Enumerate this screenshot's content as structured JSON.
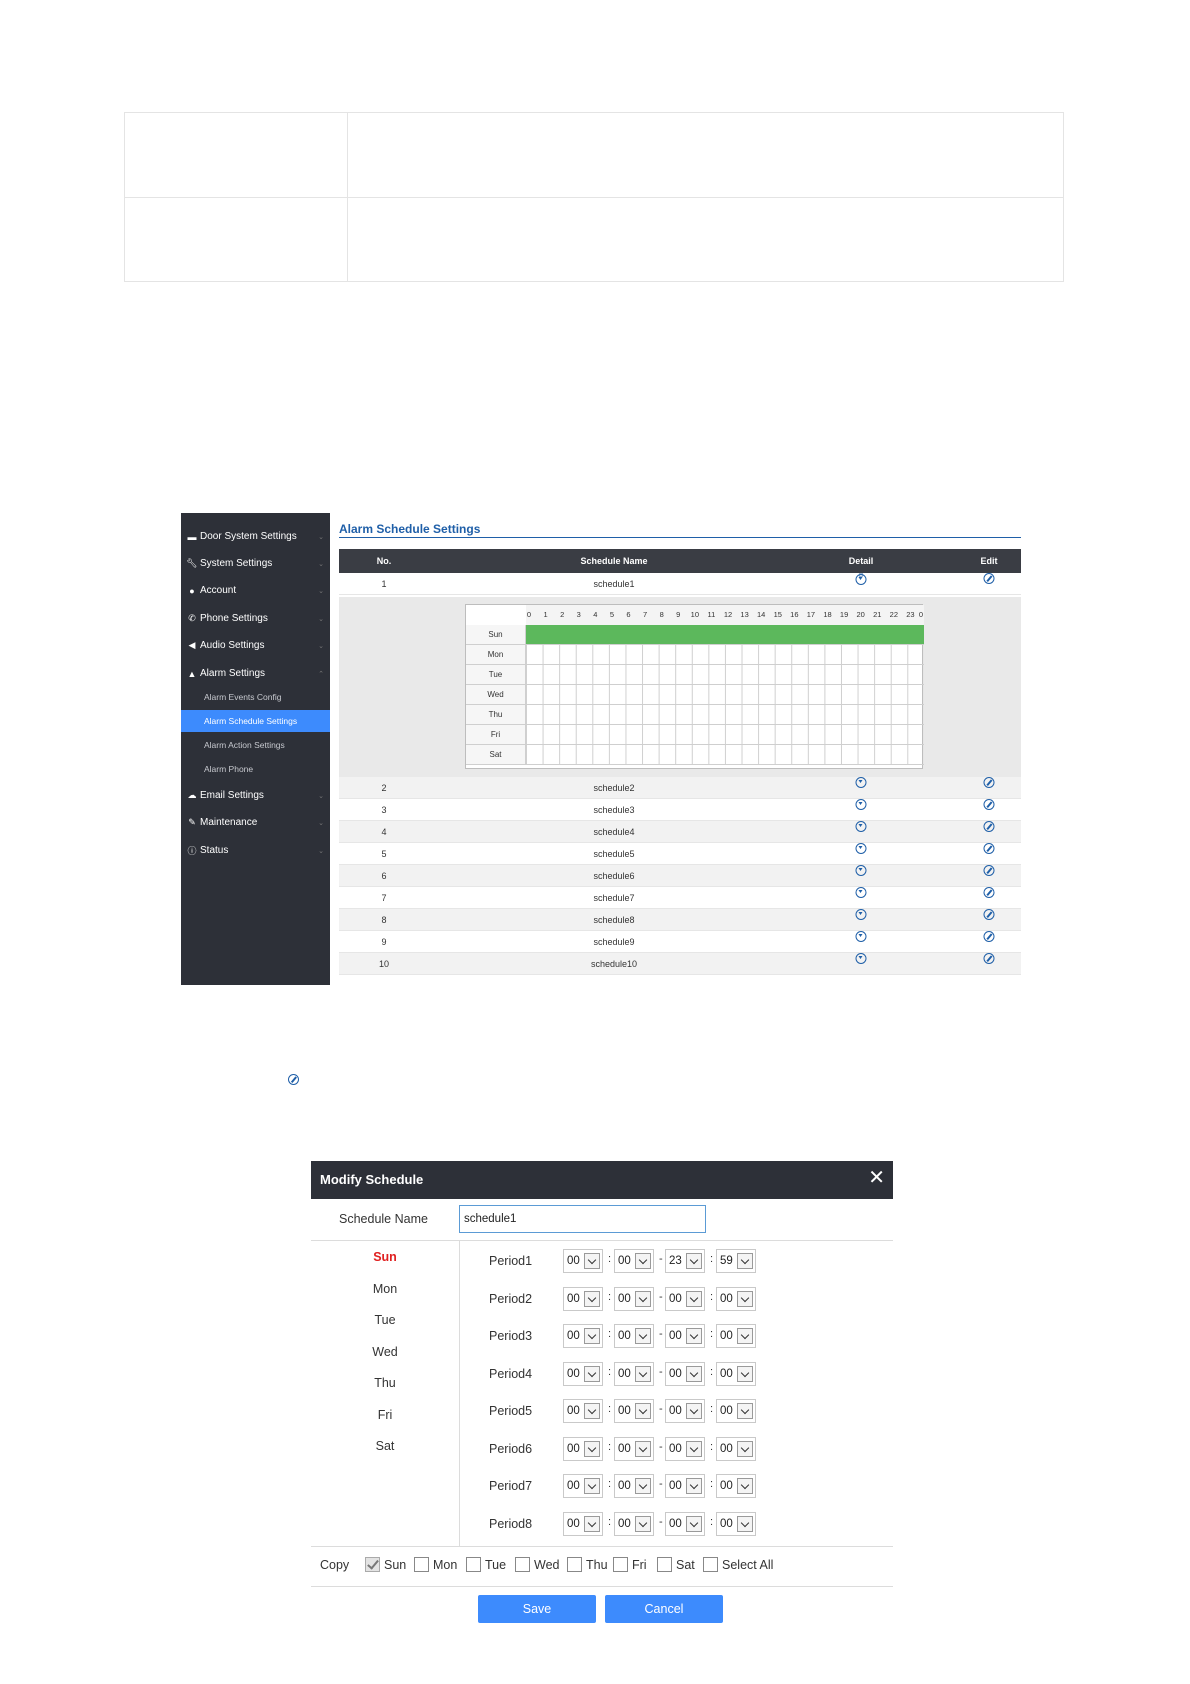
{
  "sidebar": {
    "items": [
      {
        "label": "Door System Settings",
        "icon": "card-icon"
      },
      {
        "label": "System Settings",
        "icon": "wrench-icon"
      },
      {
        "label": "Account",
        "icon": "user-icon"
      },
      {
        "label": "Phone Settings",
        "icon": "phone-icon"
      },
      {
        "label": "Audio Settings",
        "icon": "speaker-icon"
      },
      {
        "label": "Alarm Settings",
        "icon": "bell-icon"
      },
      {
        "label": "Email Settings",
        "icon": "cloud-icon"
      },
      {
        "label": "Maintenance",
        "icon": "tool-icon"
      },
      {
        "label": "Status",
        "icon": "info-icon"
      }
    ],
    "alarm_sub_items": [
      {
        "label": "Alarm Events Config"
      },
      {
        "label": "Alarm Schedule Settings",
        "active": true
      },
      {
        "label": "Alarm Action Settings"
      },
      {
        "label": "Alarm Phone"
      }
    ]
  },
  "schedule_page": {
    "title": "Alarm Schedule Settings",
    "columns": {
      "no": "No.",
      "name": "Schedule Name",
      "detail": "Detail",
      "edit": "Edit"
    },
    "rows": [
      {
        "no": "1",
        "name": "schedule1"
      },
      {
        "no": "2",
        "name": "schedule2"
      },
      {
        "no": "3",
        "name": "schedule3"
      },
      {
        "no": "4",
        "name": "schedule4"
      },
      {
        "no": "5",
        "name": "schedule5"
      },
      {
        "no": "6",
        "name": "schedule6"
      },
      {
        "no": "7",
        "name": "schedule7"
      },
      {
        "no": "8",
        "name": "schedule8"
      },
      {
        "no": "9",
        "name": "schedule9"
      },
      {
        "no": "10",
        "name": "schedule10"
      }
    ],
    "detail_grid": {
      "hours": [
        "0",
        "1",
        "2",
        "3",
        "4",
        "5",
        "6",
        "7",
        "8",
        "9",
        "10",
        "11",
        "12",
        "13",
        "14",
        "15",
        "16",
        "17",
        "18",
        "19",
        "20",
        "21",
        "22",
        "23",
        "0"
      ],
      "days": [
        "Sun",
        "Mon",
        "Tue",
        "Wed",
        "Thu",
        "Fri",
        "Sat"
      ],
      "active_days": [
        "Sun"
      ],
      "active_color": "#5cb85c"
    }
  },
  "modal": {
    "title": "Modify Schedule",
    "close_icon": "close-icon",
    "name_label": "Schedule Name",
    "name_value": "schedule1",
    "days": [
      "Sun",
      "Mon",
      "Tue",
      "Wed",
      "Thu",
      "Fri",
      "Sat"
    ],
    "active_day": "Sun",
    "periods": [
      {
        "label": "Period1",
        "start_h": "00",
        "start_m": "00",
        "end_h": "23",
        "end_m": "59"
      },
      {
        "label": "Period2",
        "start_h": "00",
        "start_m": "00",
        "end_h": "00",
        "end_m": "00"
      },
      {
        "label": "Period3",
        "start_h": "00",
        "start_m": "00",
        "end_h": "00",
        "end_m": "00"
      },
      {
        "label": "Period4",
        "start_h": "00",
        "start_m": "00",
        "end_h": "00",
        "end_m": "00"
      },
      {
        "label": "Period5",
        "start_h": "00",
        "start_m": "00",
        "end_h": "00",
        "end_m": "00"
      },
      {
        "label": "Period6",
        "start_h": "00",
        "start_m": "00",
        "end_h": "00",
        "end_m": "00"
      },
      {
        "label": "Period7",
        "start_h": "00",
        "start_m": "00",
        "end_h": "00",
        "end_m": "00"
      },
      {
        "label": "Period8",
        "start_h": "00",
        "start_m": "00",
        "end_h": "00",
        "end_m": "00"
      }
    ],
    "copy_label": "Copy",
    "copy_options": [
      {
        "label": "Sun",
        "checked": true
      },
      {
        "label": "Mon",
        "checked": false
      },
      {
        "label": "Tue",
        "checked": false
      },
      {
        "label": "Wed",
        "checked": false
      },
      {
        "label": "Thu",
        "checked": false
      },
      {
        "label": "Fri",
        "checked": false
      },
      {
        "label": "Sat",
        "checked": false
      },
      {
        "label": "Select All",
        "checked": false
      }
    ],
    "save_label": "Save",
    "cancel_label": "Cancel",
    "accent_color": "#3d8bfd",
    "active_day_color": "#e02020"
  }
}
